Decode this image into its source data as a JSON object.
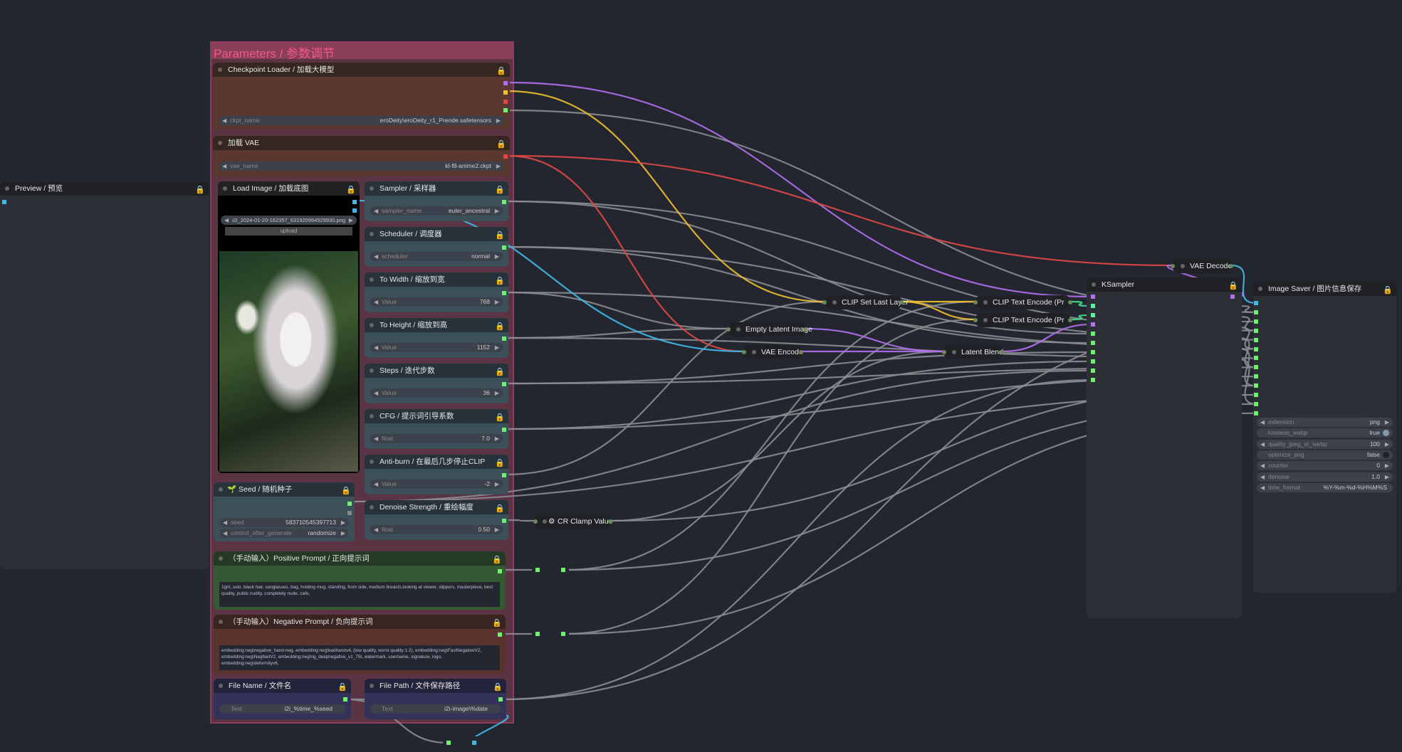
{
  "group_title": "Parameters / 参数调节",
  "wire_colors": {
    "model": "#b070f0",
    "clip": "#f0c030",
    "vae": "#e04848",
    "image": "#40b8e8",
    "cond": "#40e090",
    "latent": "#b070f0",
    "other": "#8a8c90"
  },
  "preview": {
    "title": "Preview / 预览"
  },
  "checkpoint": {
    "title": "Checkpoint Loader / 加载大模型",
    "label": "ckpt_name",
    "value": "eroDeity\\eroDeity_r1_Prende.safetensors"
  },
  "vae": {
    "title": "加载 VAE",
    "label": "vae_name",
    "value": "kl-f8-anime2.ckpt"
  },
  "load_image": {
    "title": "Load Image / 加载底图",
    "file": "i2i_2024-01-20-162357_631920994529930.png",
    "upload": "upload"
  },
  "sampler": {
    "title": "Sampler / 采样器",
    "label": "sampler_name",
    "value": "euler_ancestral"
  },
  "scheduler": {
    "title": "Scheduler / 调度器",
    "label": "scheduler",
    "value": "normal"
  },
  "width": {
    "title": "To Width / 缩放到宽",
    "label": "Value",
    "value": "768"
  },
  "height": {
    "title": "To Height / 缩放到高",
    "label": "Value",
    "value": "1152"
  },
  "steps": {
    "title": "Steps / 迭代步数",
    "label": "Value",
    "value": "36"
  },
  "cfg": {
    "title": "CFG / 提示词引导系数",
    "label": "float",
    "value": "7.0"
  },
  "antiburn": {
    "title": "Anti-burn / 在最后几步停止CLIP",
    "label": "Value",
    "value": "-2"
  },
  "denoise": {
    "title": "Denoise Strength / 重绘幅度",
    "label": "float",
    "value": "0.50"
  },
  "seed": {
    "title": "Seed / 随机种子",
    "seed_label": "seed",
    "seed_value": "583710545397713",
    "cag_label": "control_after_generate",
    "cag_value": "randomize"
  },
  "positive": {
    "title": "（手动输入）Positive Prompt / 正向提示词",
    "text": "1girl, solo, black hair, sunglasses, bag, holding mug, standing, from side, medium breasts,looking at viewer, slippers, masterpiece, best quality, public nudity, completely nude, cafe,"
  },
  "negative": {
    "title": "（手动输入）Negative Prompt / 负向提示词",
    "text": "embedding:neg\\negative_hand-neg, embedding:neg\\badhandv4, (low quality, worst quality:1.2), embedding:neg\\FastNegativeV2, embedding:neg\\NegfeetV2, embedding:neg\\ng_deepnegative_v1_75t, watermark, username, signature, logo, embedding:neg\\deformityv6,"
  },
  "file_name": {
    "title": "File Name / 文件名",
    "label": "Text",
    "value": "i2i_%time_%seed"
  },
  "file_path": {
    "title": "File Path / 文件保存路径",
    "label": "Text",
    "value": "i2i-image\\%date"
  },
  "cr_clamp": {
    "title": "CR Clamp Value"
  },
  "clip_last": {
    "title": "CLIP Set Last Layer"
  },
  "cte1": {
    "title": "CLIP Text Encode (Pr"
  },
  "cte2": {
    "title": "CLIP Text Encode (Pr"
  },
  "empty_latent": {
    "title": "Empty Latent Image"
  },
  "vae_encode": {
    "title": "VAE Encode"
  },
  "latent_blend": {
    "title": "Latent Blend"
  },
  "vae_decode": {
    "title": "VAE Decode"
  },
  "ksampler": {
    "title": "KSampler"
  },
  "image_saver": {
    "title": "Image Saver / 图片信息保存",
    "widgets": [
      {
        "label": "extension",
        "value": "png"
      },
      {
        "label": "lossless_webp",
        "value": "true"
      },
      {
        "label": "quality_jpeg_or_webp",
        "value": "100"
      },
      {
        "label": "optimize_png",
        "value": "false"
      },
      {
        "label": "counter",
        "value": "0"
      },
      {
        "label": "denoise",
        "value": "1.0"
      },
      {
        "label": "time_format",
        "value": "%Y-%m-%d-%H%M%S"
      }
    ]
  }
}
